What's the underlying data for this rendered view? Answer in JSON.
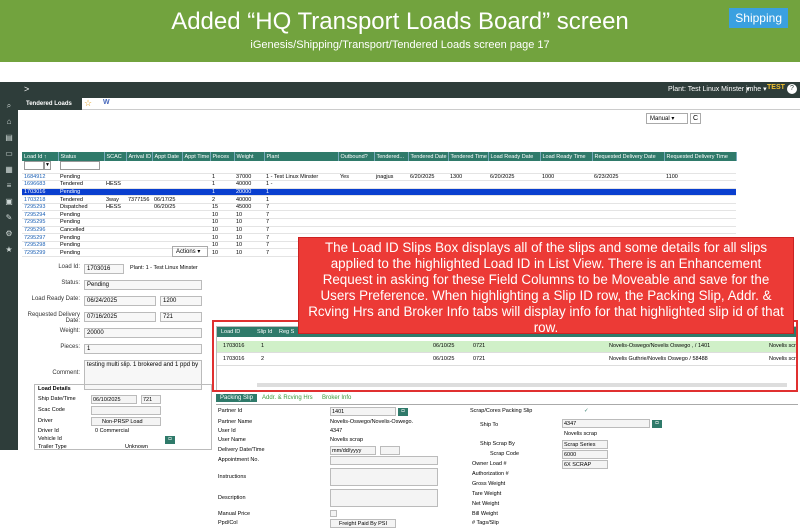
{
  "banner": {
    "title": "Added “HQ Transport Loads Board” screen",
    "subtitle": "iGenesis/Shipping/Transport/Tendered Loads screen page 17",
    "badge": "Shipping"
  },
  "topbar": {
    "chevron": ">",
    "plant": "Plant: Test Linux Minster ▾",
    "user": "jmhe ▾",
    "env": "TEST",
    "help": "?"
  },
  "tab": {
    "label": "Tendered Loads",
    "star": "☆",
    "w": "W"
  },
  "grid": {
    "manual": "Manual ▾",
    "refresh": "C",
    "headers": [
      "Load Id ↑",
      "Status",
      "SCAC",
      "Arrival ID",
      "Appt Date",
      "Appt Time",
      "Pieces",
      "Weight",
      "Plant",
      "Outbound?",
      "Tendered...",
      "Tendered Date",
      "Tendered Time",
      "Load Ready Date",
      "Load Ready Time",
      "Requested Delivery Date",
      "Requested Delivery Time"
    ],
    "rows": [
      [
        "1684912",
        "Pending",
        "",
        "",
        "",
        "",
        "1",
        "37000",
        "1 - Test Linux Minster",
        "Yes",
        "jnagjus",
        "6/20/2025",
        "1300",
        "6/20/2025",
        "1000",
        "6/23/2025",
        "1100"
      ],
      [
        "1696683",
        "Tendered",
        "HESS",
        "",
        "",
        "",
        "1",
        "40000",
        "1 -",
        "",
        "",
        "",
        "",
        "",
        "",
        "",
        ""
      ],
      [
        "1703016",
        "Pending",
        "",
        "",
        "",
        "",
        "1",
        "20000",
        "1",
        "",
        "",
        "",
        "",
        "",
        "",
        "",
        ""
      ],
      [
        "1703218",
        "Tendered",
        "3way",
        "7377156",
        "06/17/25",
        "",
        "2",
        "40000",
        "1",
        "",
        "",
        "",
        "",
        "",
        "",
        "",
        ""
      ],
      [
        "7295293",
        "Dispatched",
        "HESS",
        "",
        "06/20/25",
        "",
        "15",
        "45000",
        "7",
        "",
        "",
        "",
        "",
        "",
        "",
        "",
        ""
      ],
      [
        "7295294",
        "Pending",
        "",
        "",
        "",
        "",
        "10",
        "10",
        "7",
        "",
        "",
        "",
        "",
        "",
        "",
        "",
        ""
      ],
      [
        "7295295",
        "Pending",
        "",
        "",
        "",
        "",
        "10",
        "10",
        "7",
        "",
        "",
        "",
        "",
        "",
        "",
        "",
        ""
      ],
      [
        "7295296",
        "Cancelled",
        "",
        "",
        "",
        "",
        "10",
        "10",
        "7",
        "",
        "",
        "",
        "",
        "",
        "",
        "",
        ""
      ],
      [
        "7295297",
        "Pending",
        "",
        "",
        "",
        "",
        "10",
        "10",
        "7",
        "",
        "",
        "",
        "",
        "",
        "",
        "",
        ""
      ],
      [
        "7295298",
        "Pending",
        "",
        "",
        "",
        "",
        "10",
        "10",
        "7",
        "",
        "",
        "",
        "",
        "",
        "",
        "",
        ""
      ],
      [
        "7295299",
        "Pending",
        "",
        "",
        "",
        "",
        "10",
        "10",
        "7",
        "",
        "",
        "",
        "",
        "",
        "",
        "",
        ""
      ]
    ]
  },
  "callout": "The Load ID Slips Box displays all of the slips and some details for all slips applied to the highlighted Load ID in List View. There is an Enhancement Request in asking for these Field Columns to be Moveable and save for the Users Preference. When highlighting a Slip ID row, the Packing Slip, Addr. & Rcving Hrs and Broker Info tabs will display info for that highlighted slip id of that row.",
  "detail": {
    "actions": "Actions ▾",
    "load_id_label": "Load Id:",
    "load_id": "1703016",
    "plant": "Plant: 1 - Test Linux Minster",
    "status_label": "Status:",
    "status": "Pending",
    "ready_label": "Load Ready Date:",
    "ready_date": "06/24/2025",
    "ready_time": "1200",
    "req_label": "Requested Delivery Date:",
    "req_date": "07/16/2025",
    "req_time": "721",
    "weight_label": "Weight:",
    "weight": "20000",
    "pieces_label": "Pieces:",
    "pieces": "1",
    "comment_label": "Comment:",
    "comment": "testing multi slip. 1 brokered and 1 ppd by"
  },
  "load_details": {
    "title": "Load Details",
    "ship_label": "Ship Date/Time",
    "ship_date": "06/10/2025",
    "ship_time": "721",
    "scac_label": "Scac Code",
    "driver_label": "Driver",
    "driver": "Non-PRSP Load",
    "driverid_label": "Driver Id",
    "driverid": "0 Commercial",
    "vehicle_label": "Vehicle Id",
    "trailer_label": "Trailer Type",
    "trailer": "Unknown"
  },
  "slips": {
    "headers": [
      "Load ID",
      "Slip Id",
      "Reg S"
    ],
    "rows": [
      {
        "load": "1703016",
        "slip": "1",
        "date": "06/10/25",
        "time": "0721",
        "dest": "Novelis-Oswego/Novelis Oswego , / 1401",
        "tail": "Novelis scr"
      },
      {
        "load": "1703016",
        "slip": "2",
        "date": "06/10/25",
        "time": "0721",
        "dest": "Novelis Guthrie/Novelis Oswego / 58488",
        "tail": "Novelis scr"
      }
    ]
  },
  "subtabs": [
    "Packing Slip",
    "Addr. & Rcving Hrs",
    "Broker Info"
  ],
  "packing": {
    "partner_id_label": "Partner Id",
    "partner_id": "1401",
    "partner_name_label": "Partner Name",
    "partner_name": "Novelis-Oswego/Novelis-Oswego.",
    "user_id_label": "User Id",
    "user_id": "4347",
    "user_name_label": "User Name",
    "user_name": "Novelis scrap",
    "delivery_label": "Delivery Date/Time",
    "delivery": "mm/dd/yyyy",
    "appt_label": "Appointment No.",
    "instructions_label": "Instructions",
    "description_label": "Description",
    "manual_price_label": "Manual Price",
    "ppd_label": "Ppd/Col",
    "ppd": "Freight Paid By PSI",
    "scrap_label": "Scrap/Cores Packing Slip",
    "scrap_check": "✓",
    "ship_to_label": "Ship To",
    "ship_to": "4347",
    "ship_to_name": "Novelis scrap",
    "ship_by_label": "Ship Scrap By",
    "ship_by": "Scrap Series",
    "scrap_code_label": "Scrap Code",
    "scrap_code": "6000",
    "owner_label": "Owner Load #",
    "owner": "6X SCRAP",
    "auth_label": "Authorization #",
    "gross_label": "Gross Weight",
    "tare_label": "Tare Weight",
    "net_label": "Net Weight",
    "bill_label": "Bill Weight",
    "tags_label": "# Tags/Slip"
  }
}
